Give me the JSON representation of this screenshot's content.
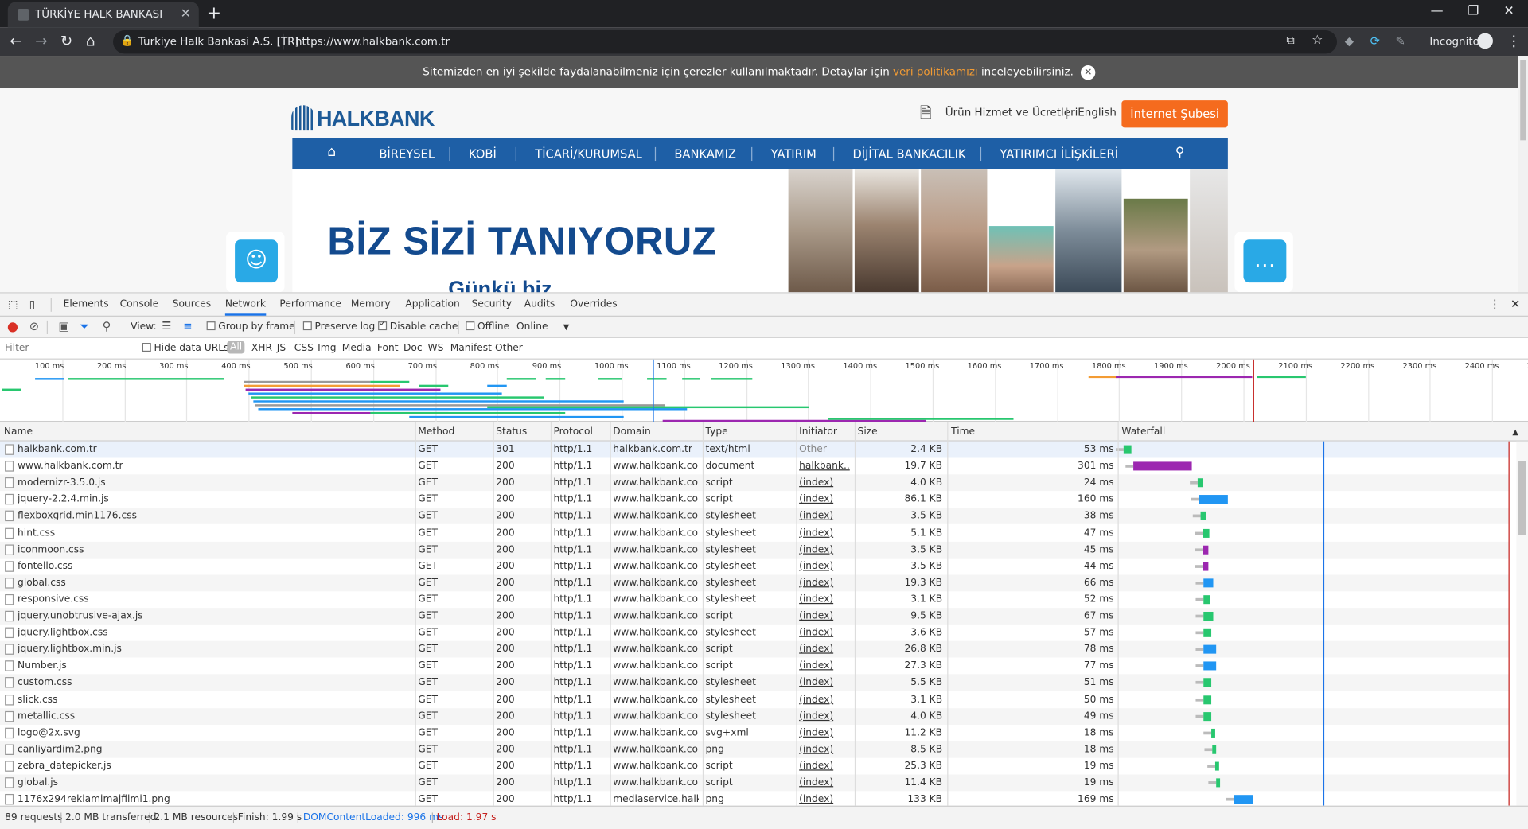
{
  "browser": {
    "tab_title": "TÜRKİYE HALK BANKASI",
    "tab_close": "✕",
    "new_tab": "+",
    "url_org": "Turkiye Halk Bankasi A.S. [TR]",
    "url": "https://www.halkbank.com.tr",
    "incognito_label": "Incognito",
    "window_controls": [
      "—",
      "❐",
      "✕"
    ]
  },
  "page": {
    "cookie_text": "Sitemizden en iyi şekilde faydalanabilmeniz için çerezler kullanılmaktadır. Detaylar için",
    "cookie_link": "veri politikamızı",
    "cookie_suffix": "inceleyebilirsiniz.",
    "logo": "HALKBANK",
    "fees_link": "Ürün Hizmet ve Ücretleri",
    "divider": "|",
    "language": "English",
    "internet_branch": "İnternet Şubesi",
    "nav_items": [
      "BİREYSEL",
      "KOBİ",
      "TİCARİ/KURUMSAL",
      "BANKAMIZ",
      "YATIRIM",
      "DİJİTAL BANKACILIK",
      "YATIRIMCI İLİŞKİLERİ"
    ],
    "banner_title": "BİZ SİZİ TANIYORUZ",
    "banner_subtitle": "Günkü biz"
  },
  "devtools": {
    "tabs": [
      "Elements",
      "Console",
      "Sources",
      "Network",
      "Performance",
      "Memory",
      "Application",
      "Security",
      "Audits",
      "Overrides"
    ],
    "active_tab": "Network",
    "view_label": "View:",
    "group_by_frame": "Group by frame",
    "preserve_log": "Preserve log",
    "disable_cache": "Disable cache",
    "offline": "Offline",
    "throttle": "Online",
    "filter_placeholder": "Filter",
    "hide_data_urls": "Hide data URLs",
    "filter_types": [
      "All",
      "XHR",
      "JS",
      "CSS",
      "Img",
      "Media",
      "Font",
      "Doc",
      "WS",
      "Manifest",
      "Other"
    ],
    "timeline_ticks": [
      "100 ms",
      "200 ms",
      "300 ms",
      "400 ms",
      "500 ms",
      "600 ms",
      "700 ms",
      "800 ms",
      "900 ms",
      "1000 ms",
      "1100 ms",
      "1200 ms",
      "1300 ms",
      "1400 ms",
      "1500 ms",
      "1600 ms",
      "1700 ms",
      "1800 ms",
      "1900 ms",
      "2000 ms",
      "2100 ms",
      "2200 ms",
      "2300 ms",
      "2400 ms",
      "25"
    ],
    "columns": [
      "Name",
      "Method",
      "Status",
      "Protocol",
      "Domain",
      "Type",
      "Initiator",
      "Size",
      "Time",
      "Waterfall"
    ],
    "rows": [
      {
        "name": "halkbank.com.tr",
        "method": "GET",
        "status": "301",
        "protocol": "http/1.1",
        "domain": "halkbank.com.tr",
        "type": "text/html",
        "initiator": "Other",
        "size": "2.4 KB",
        "time": "53 ms"
      },
      {
        "name": "www.halkbank.com.tr",
        "method": "GET",
        "status": "200",
        "protocol": "http/1.1",
        "domain": "www.halkbank.co...",
        "type": "document",
        "initiator": "halkbank....",
        "size": "19.7 KB",
        "time": "301 ms"
      },
      {
        "name": "modernizr-3.5.0.js",
        "method": "GET",
        "status": "200",
        "protocol": "http/1.1",
        "domain": "www.halkbank.co...",
        "type": "script",
        "initiator": "(index)",
        "size": "4.0 KB",
        "time": "24 ms"
      },
      {
        "name": "jquery-2.2.4.min.js",
        "method": "GET",
        "status": "200",
        "protocol": "http/1.1",
        "domain": "www.halkbank.co...",
        "type": "script",
        "initiator": "(index)",
        "size": "86.1 KB",
        "time": "160 ms"
      },
      {
        "name": "flexboxgrid.min1176.css",
        "method": "GET",
        "status": "200",
        "protocol": "http/1.1",
        "domain": "www.halkbank.co...",
        "type": "stylesheet",
        "initiator": "(index)",
        "size": "3.5 KB",
        "time": "38 ms"
      },
      {
        "name": "hint.css",
        "method": "GET",
        "status": "200",
        "protocol": "http/1.1",
        "domain": "www.halkbank.co...",
        "type": "stylesheet",
        "initiator": "(index)",
        "size": "5.1 KB",
        "time": "47 ms"
      },
      {
        "name": "iconmoon.css",
        "method": "GET",
        "status": "200",
        "protocol": "http/1.1",
        "domain": "www.halkbank.co...",
        "type": "stylesheet",
        "initiator": "(index)",
        "size": "3.5 KB",
        "time": "45 ms"
      },
      {
        "name": "fontello.css",
        "method": "GET",
        "status": "200",
        "protocol": "http/1.1",
        "domain": "www.halkbank.co...",
        "type": "stylesheet",
        "initiator": "(index)",
        "size": "3.5 KB",
        "time": "44 ms"
      },
      {
        "name": "global.css",
        "method": "GET",
        "status": "200",
        "protocol": "http/1.1",
        "domain": "www.halkbank.co...",
        "type": "stylesheet",
        "initiator": "(index)",
        "size": "19.3 KB",
        "time": "66 ms"
      },
      {
        "name": "responsive.css",
        "method": "GET",
        "status": "200",
        "protocol": "http/1.1",
        "domain": "www.halkbank.co...",
        "type": "stylesheet",
        "initiator": "(index)",
        "size": "3.1 KB",
        "time": "52 ms"
      },
      {
        "name": "jquery.unobtrusive-ajax.js",
        "method": "GET",
        "status": "200",
        "protocol": "http/1.1",
        "domain": "www.halkbank.co...",
        "type": "script",
        "initiator": "(index)",
        "size": "9.5 KB",
        "time": "67 ms"
      },
      {
        "name": "jquery.lightbox.css",
        "method": "GET",
        "status": "200",
        "protocol": "http/1.1",
        "domain": "www.halkbank.co...",
        "type": "stylesheet",
        "initiator": "(index)",
        "size": "3.6 KB",
        "time": "57 ms"
      },
      {
        "name": "jquery.lightbox.min.js",
        "method": "GET",
        "status": "200",
        "protocol": "http/1.1",
        "domain": "www.halkbank.co...",
        "type": "script",
        "initiator": "(index)",
        "size": "26.8 KB",
        "time": "78 ms"
      },
      {
        "name": "Number.js",
        "method": "GET",
        "status": "200",
        "protocol": "http/1.1",
        "domain": "www.halkbank.co...",
        "type": "script",
        "initiator": "(index)",
        "size": "27.3 KB",
        "time": "77 ms"
      },
      {
        "name": "custom.css",
        "method": "GET",
        "status": "200",
        "protocol": "http/1.1",
        "domain": "www.halkbank.co...",
        "type": "stylesheet",
        "initiator": "(index)",
        "size": "5.5 KB",
        "time": "51 ms"
      },
      {
        "name": "slick.css",
        "method": "GET",
        "status": "200",
        "protocol": "http/1.1",
        "domain": "www.halkbank.co...",
        "type": "stylesheet",
        "initiator": "(index)",
        "size": "3.1 KB",
        "time": "50 ms"
      },
      {
        "name": "metallic.css",
        "method": "GET",
        "status": "200",
        "protocol": "http/1.1",
        "domain": "www.halkbank.co...",
        "type": "stylesheet",
        "initiator": "(index)",
        "size": "4.0 KB",
        "time": "49 ms"
      },
      {
        "name": "logo@2x.svg",
        "method": "GET",
        "status": "200",
        "protocol": "http/1.1",
        "domain": "www.halkbank.co...",
        "type": "svg+xml",
        "initiator": "(index)",
        "size": "11.2 KB",
        "time": "18 ms"
      },
      {
        "name": "canliyardim2.png",
        "method": "GET",
        "status": "200",
        "protocol": "http/1.1",
        "domain": "www.halkbank.co...",
        "type": "png",
        "initiator": "(index)",
        "size": "8.5 KB",
        "time": "18 ms"
      },
      {
        "name": "zebra_datepicker.js",
        "method": "GET",
        "status": "200",
        "protocol": "http/1.1",
        "domain": "www.halkbank.co...",
        "type": "script",
        "initiator": "(index)",
        "size": "25.3 KB",
        "time": "19 ms"
      },
      {
        "name": "global.js",
        "method": "GET",
        "status": "200",
        "protocol": "http/1.1",
        "domain": "www.halkbank.co...",
        "type": "script",
        "initiator": "(index)",
        "size": "11.4 KB",
        "time": "19 ms"
      },
      {
        "name": "1176x294reklamimajfilmi1.png",
        "method": "GET",
        "status": "200",
        "protocol": "http/1.1",
        "domain": "mediaservice.halk...",
        "type": "png",
        "initiator": "(index)",
        "size": "133 KB",
        "time": "169 ms"
      }
    ],
    "summary": {
      "requests": "89 requests",
      "transferred": "2.0 MB transferred",
      "resources": "2.1 MB resources",
      "finish": "Finish: 1.99 s",
      "dcl": "DOMContentLoaded: 996 ms",
      "load": "Load: 1.97 s"
    }
  },
  "colors": {
    "brand": "#1e5fa6",
    "orange": "#f56b1e",
    "dcl": "#1a73e8",
    "load": "#c5221f"
  }
}
